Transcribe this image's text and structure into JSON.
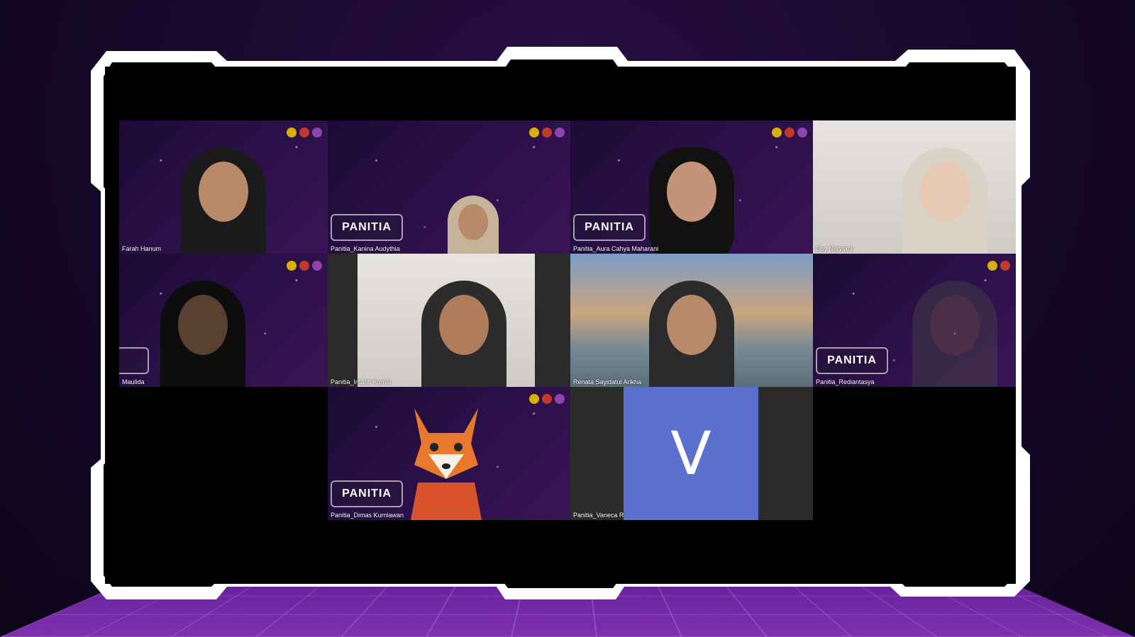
{
  "meeting": {
    "participants": [
      {
        "name": "Farah Hanum",
        "badge": ""
      },
      {
        "name": "Panitia_Kanina Audythia",
        "badge": "PANITIA"
      },
      {
        "name": "Panitia_Aura Cahya Maharani",
        "badge": "PANITIA"
      },
      {
        "name": "Osy Nurviani",
        "badge": ""
      },
      {
        "name": "Maulida",
        "badge": "IA"
      },
      {
        "name": "Panitia_Intanti Kurnia",
        "badge": ""
      },
      {
        "name": "Renata Sayidatul Arikha",
        "badge": ""
      },
      {
        "name": "Panitia_Rediantasya",
        "badge": "PANITIA"
      },
      {
        "name": "Panitia_Dimas Kurniawan",
        "badge": "PANITIA"
      },
      {
        "name": "Panitia_Vaneca R",
        "badge": "",
        "avatar_letter": "V"
      }
    ]
  },
  "colors": {
    "avatar_bg": "#5b6fcf",
    "frame": "#ffffff",
    "floor": "#8a34c0"
  }
}
